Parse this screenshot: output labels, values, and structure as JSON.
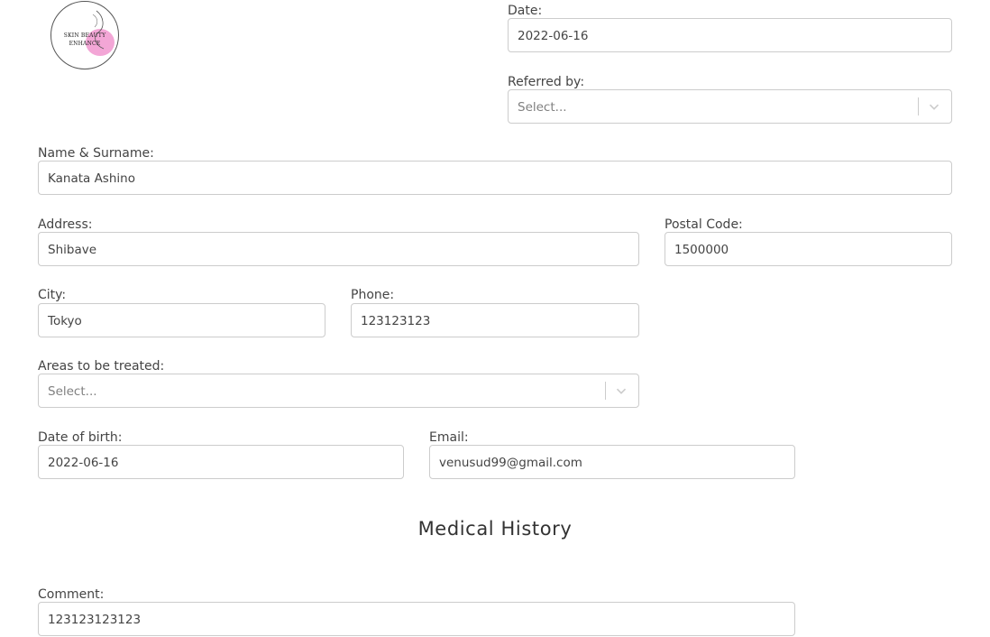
{
  "logo": {
    "text_line1": "SKIN BEAUTY",
    "text_line2": "ENHANCE"
  },
  "date": {
    "label": "Date:",
    "value": "2022-06-16"
  },
  "referred_by": {
    "label": "Referred by:",
    "placeholder": "Select..."
  },
  "name": {
    "label": "Name & Surname:",
    "value": "Kanata Ashino"
  },
  "address": {
    "label": "Address:",
    "value": "Shibave"
  },
  "postal_code": {
    "label": "Postal Code:",
    "value": "1500000"
  },
  "city": {
    "label": "City:",
    "value": "Tokyo"
  },
  "phone": {
    "label": "Phone:",
    "value": "123123123"
  },
  "areas": {
    "label": "Areas to be treated:",
    "placeholder": "Select..."
  },
  "dob": {
    "label": "Date of birth:",
    "value": "2022-06-16"
  },
  "email": {
    "label": "Email:",
    "value": "venusud99@gmail.com"
  },
  "medical_history": {
    "title": "Medical History"
  },
  "comment": {
    "label": "Comment:",
    "value": "123123123123"
  },
  "icons": {
    "dropdown": "chevron-down-icon"
  },
  "colors": {
    "border": "#cccccc",
    "logo_accent": "#f3a6d6",
    "text": "#444444"
  }
}
